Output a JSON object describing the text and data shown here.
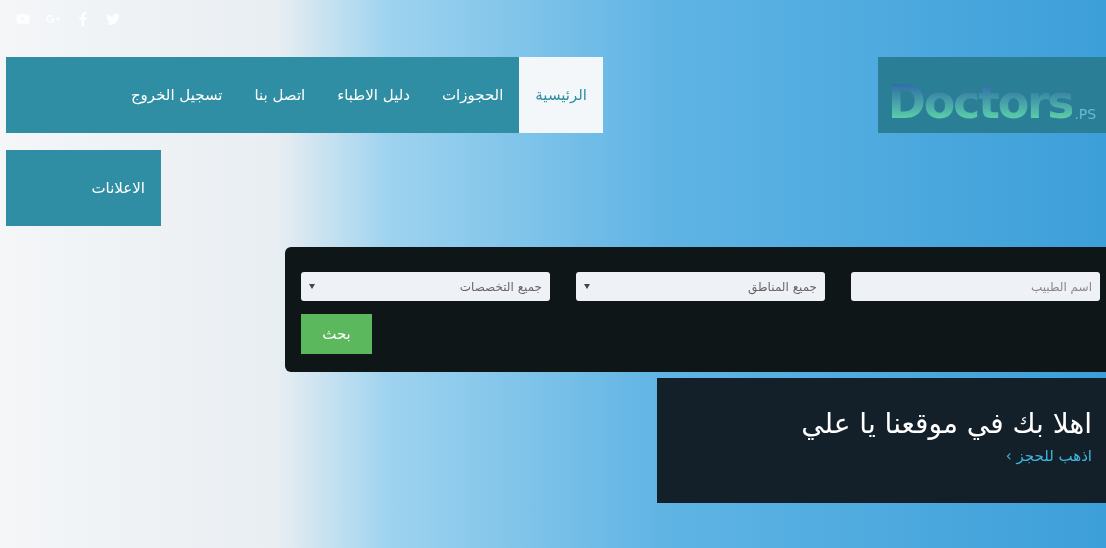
{
  "social_icons": [
    {
      "kind": "youtube"
    },
    {
      "kind": "googleplus"
    },
    {
      "kind": "facebook"
    },
    {
      "kind": "twitter"
    }
  ],
  "nav": {
    "items": [
      {
        "label": "الرئيسية",
        "selected": true
      },
      {
        "label": "الحجوزات",
        "selected": false
      },
      {
        "label": "دليل الاطباء",
        "selected": false
      },
      {
        "label": "اتصل بنا",
        "selected": false
      },
      {
        "label": "تسجيل الخروج",
        "selected": false
      }
    ],
    "extra_item": "الاعلانات"
  },
  "logo": {
    "name": "Doctors",
    "suffix": ".PS"
  },
  "search": {
    "fields": [
      {
        "kind": "text",
        "placeholder": "اسم الطبيب"
      },
      {
        "kind": "select",
        "value": "جميع المناطق"
      },
      {
        "kind": "select",
        "value": "جميع التخصصات"
      }
    ],
    "button": "بحث"
  },
  "welcome": {
    "title": "اهلا بك في موقعنا يا علي",
    "link": "اذهب للحجز",
    "link_arrow": "›"
  }
}
